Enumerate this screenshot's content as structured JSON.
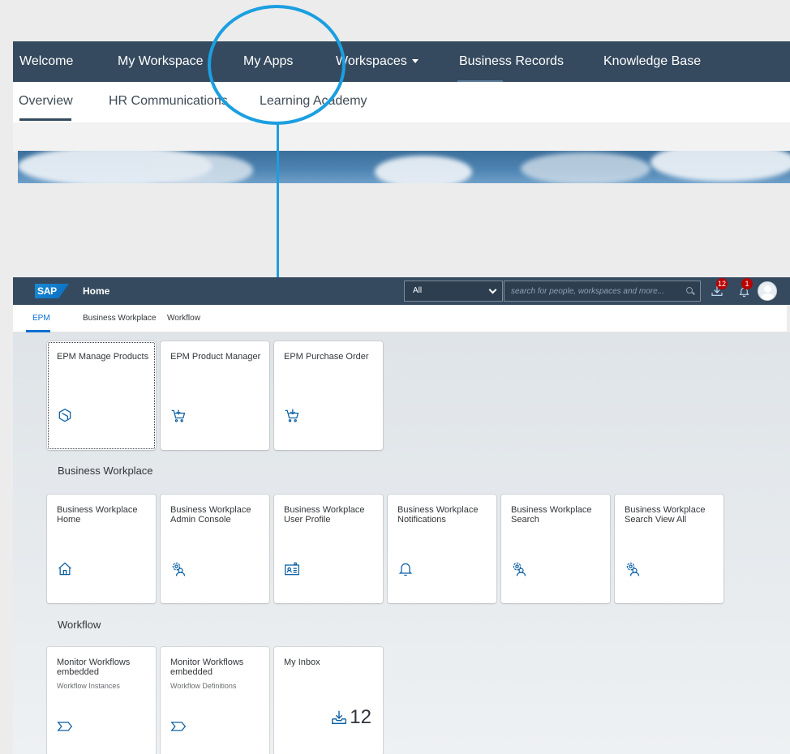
{
  "portal": {
    "top_nav": [
      "Welcome",
      "My Workspace",
      "My Apps",
      "Workspaces",
      "Business Records",
      "Knowledge Base"
    ],
    "sub_nav": [
      "Overview",
      "HR Communications",
      "Learning Academy"
    ]
  },
  "shell": {
    "logo": "SAP",
    "title": "Home",
    "search_scope": "All",
    "search_placeholder": "search for people, workspaces and more...",
    "notifications_download_count": "12",
    "notifications_bell_count": "1"
  },
  "lp_tabs": [
    "EPM",
    "Business Workplace",
    "Workflow"
  ],
  "groups": {
    "epm": {
      "tiles": [
        {
          "title": "EPM Manage Products",
          "icon": "product-icon"
        },
        {
          "title": "EPM Product Manager",
          "icon": "cart-icon"
        },
        {
          "title": "EPM Purchase Order",
          "icon": "cart-arrow-icon"
        }
      ]
    },
    "bw": {
      "title": "Business Workplace",
      "tiles": [
        {
          "title": "Business Workplace Home",
          "icon": "home-icon"
        },
        {
          "title": "Business Workplace Admin Console",
          "icon": "user-settings-icon"
        },
        {
          "title": "Business Workplace User Profile",
          "icon": "id-card-icon"
        },
        {
          "title": "Business Workplace Notifications",
          "icon": "bell-icon"
        },
        {
          "title": "Business Workplace Search",
          "icon": "user-settings-icon"
        },
        {
          "title": "Business Workplace Search View All",
          "icon": "user-settings-icon"
        }
      ]
    },
    "wf": {
      "title": "Workflow",
      "tiles": [
        {
          "title": "Monitor Workflows embedded",
          "subtitle": "Workflow Instances",
          "icon": "process-icon"
        },
        {
          "title": "Monitor Workflows embedded",
          "subtitle": "Workflow Definitions",
          "icon": "process-icon"
        },
        {
          "title": "My Inbox",
          "count": "12",
          "icon": "inbox-icon"
        }
      ]
    }
  },
  "colors": {
    "shell": "#354a5f",
    "accent": "#0a6ed1",
    "callout": "#1b9fe0"
  }
}
